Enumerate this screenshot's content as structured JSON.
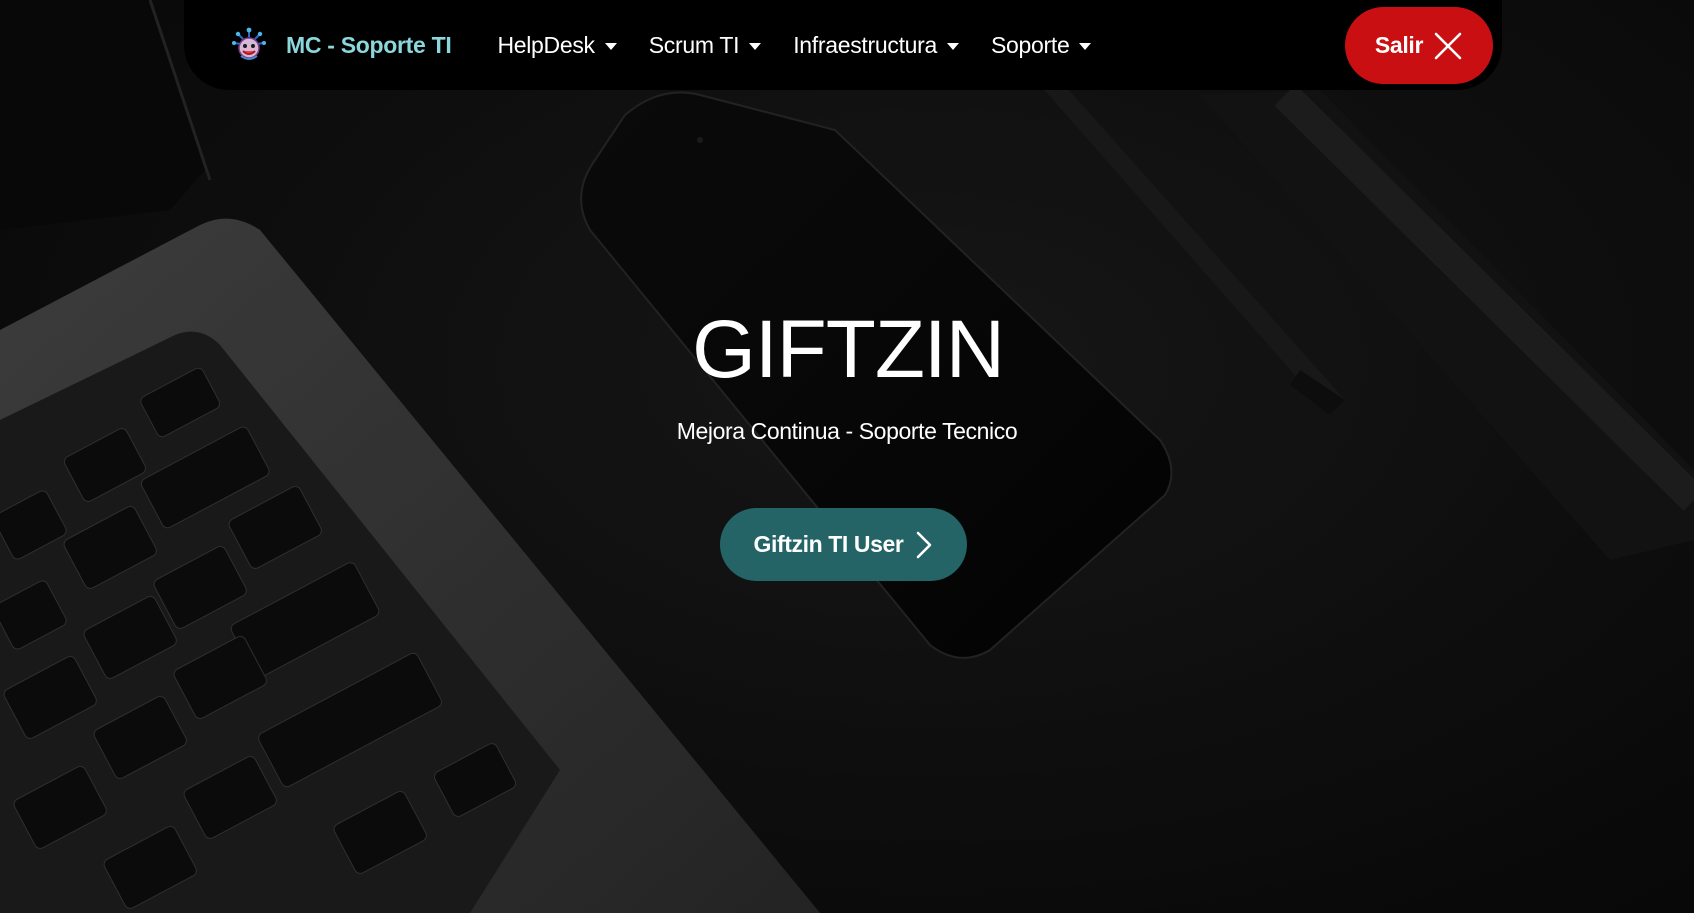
{
  "navbar": {
    "brand": "MC - Soporte TI",
    "brand_logo_icon": "jester-mascot-icon",
    "items": [
      {
        "label": "HelpDesk",
        "icon": "caret-down-icon"
      },
      {
        "label": "Scrum TI",
        "icon": "caret-down-icon"
      },
      {
        "label": "Infraestructura",
        "icon": "caret-down-icon"
      },
      {
        "label": "Soporte",
        "icon": "caret-down-icon"
      }
    ],
    "logout": {
      "label": "Salir",
      "icon": "close-icon"
    }
  },
  "hero": {
    "title": "GIFTZIN",
    "subtitle": "Mejora Continua - Soporte Tecnico",
    "cta": {
      "label": "Giftzin TI User",
      "icon": "chevron-right-icon"
    }
  },
  "colors": {
    "navbar_bg": "#000000",
    "brand_text": "#8ad7dc",
    "logout_bg": "#c90f12",
    "cta_bg": "#246466",
    "text": "#ffffff"
  }
}
